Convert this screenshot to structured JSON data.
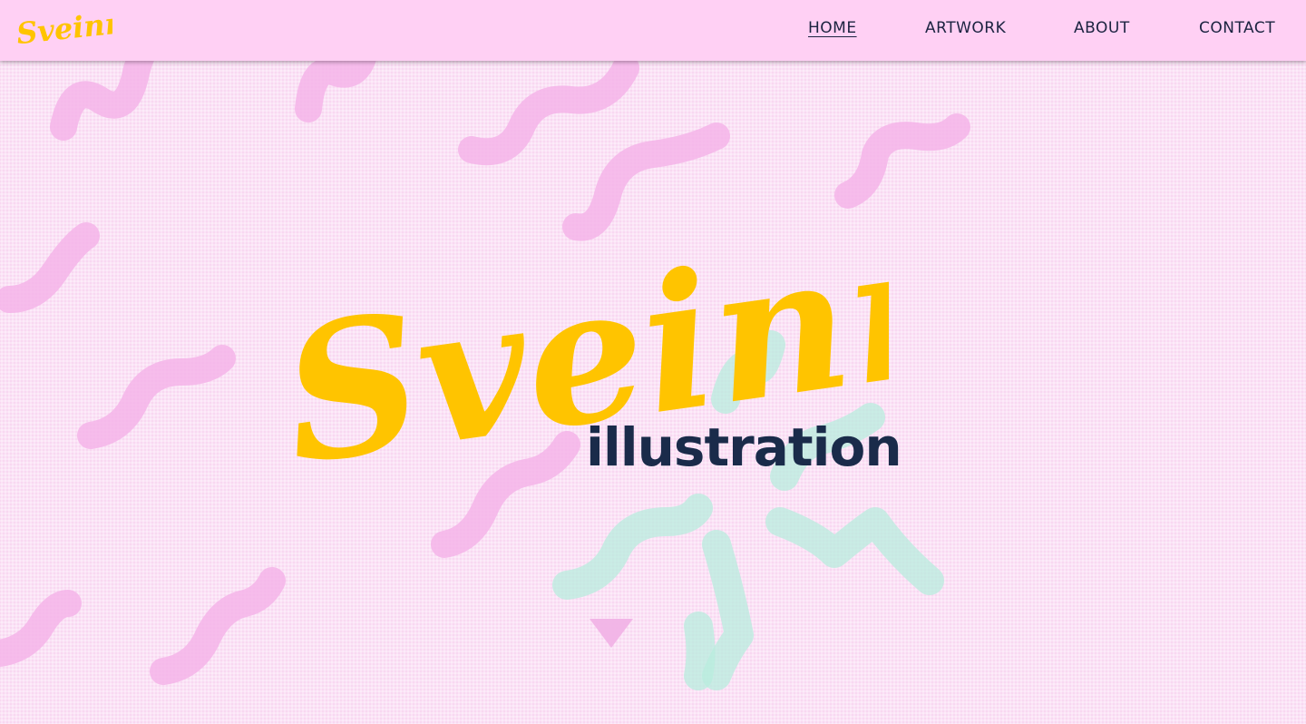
{
  "header": {
    "logo_text": "Sveinn S.",
    "nav": [
      {
        "label": "HOME",
        "active": true
      },
      {
        "label": "ARTWORK",
        "active": false
      },
      {
        "label": "ABOUT",
        "active": false
      },
      {
        "label": "CONTACT",
        "active": false
      }
    ]
  },
  "hero": {
    "title": "Sveinn S.",
    "subtitle": "illustration",
    "scroll_icon": "triangle-down-icon"
  },
  "colors": {
    "background": "#fbe3f6",
    "navbar": "#ffd0f4",
    "logo_yellow": "#ffc400",
    "subtitle_navy": "#1a2b4a",
    "squiggle_pink": "#f5b4e9",
    "squiggle_mint": "#b8ecde",
    "nav_text": "#1b2340"
  }
}
